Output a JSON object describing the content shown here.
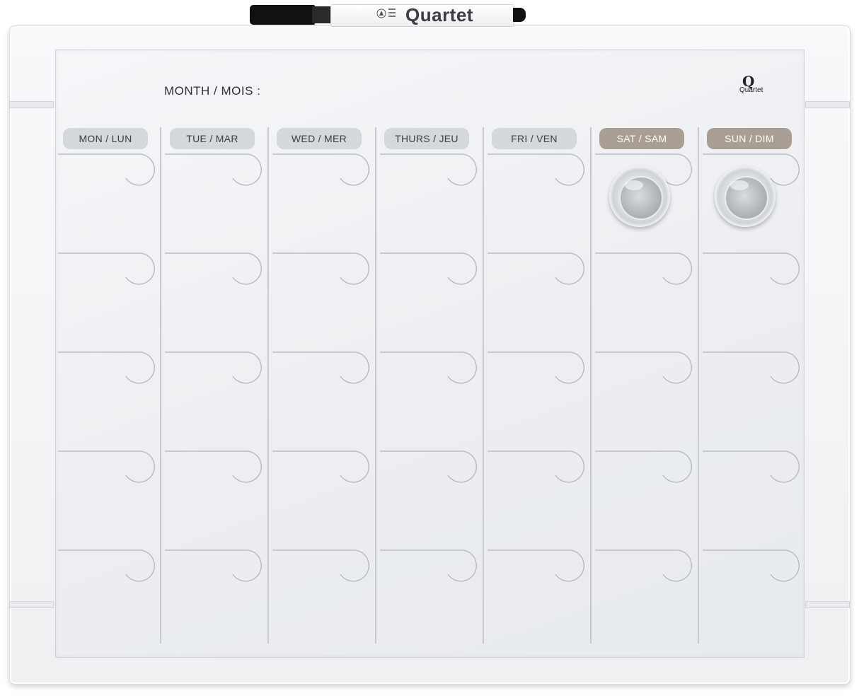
{
  "board": {
    "month_label": "MONTH / MOIS :",
    "brand_logo_text": "Quartet",
    "days": [
      {
        "label": "MON / LUN",
        "weekend": false
      },
      {
        "label": "TUE / MAR",
        "weekend": false
      },
      {
        "label": "WED / MER",
        "weekend": false
      },
      {
        "label": "THURS / JEU",
        "weekend": false
      },
      {
        "label": "FRI / VEN",
        "weekend": false
      },
      {
        "label": "SAT / SAM",
        "weekend": true
      },
      {
        "label": "SUN / DIM",
        "weekend": true
      }
    ],
    "week_rows": 5,
    "colors": {
      "weekday_header": "#d5d8db",
      "weekend_header": "#a89e94",
      "grid_line": "#b9bdc1"
    }
  },
  "marker": {
    "brand": "Quartet",
    "body_color": "#ffffff",
    "cap_color": "#111111"
  },
  "magnets": {
    "count": 2,
    "columns": [
      "SAT / SAM",
      "SUN / DIM"
    ]
  }
}
